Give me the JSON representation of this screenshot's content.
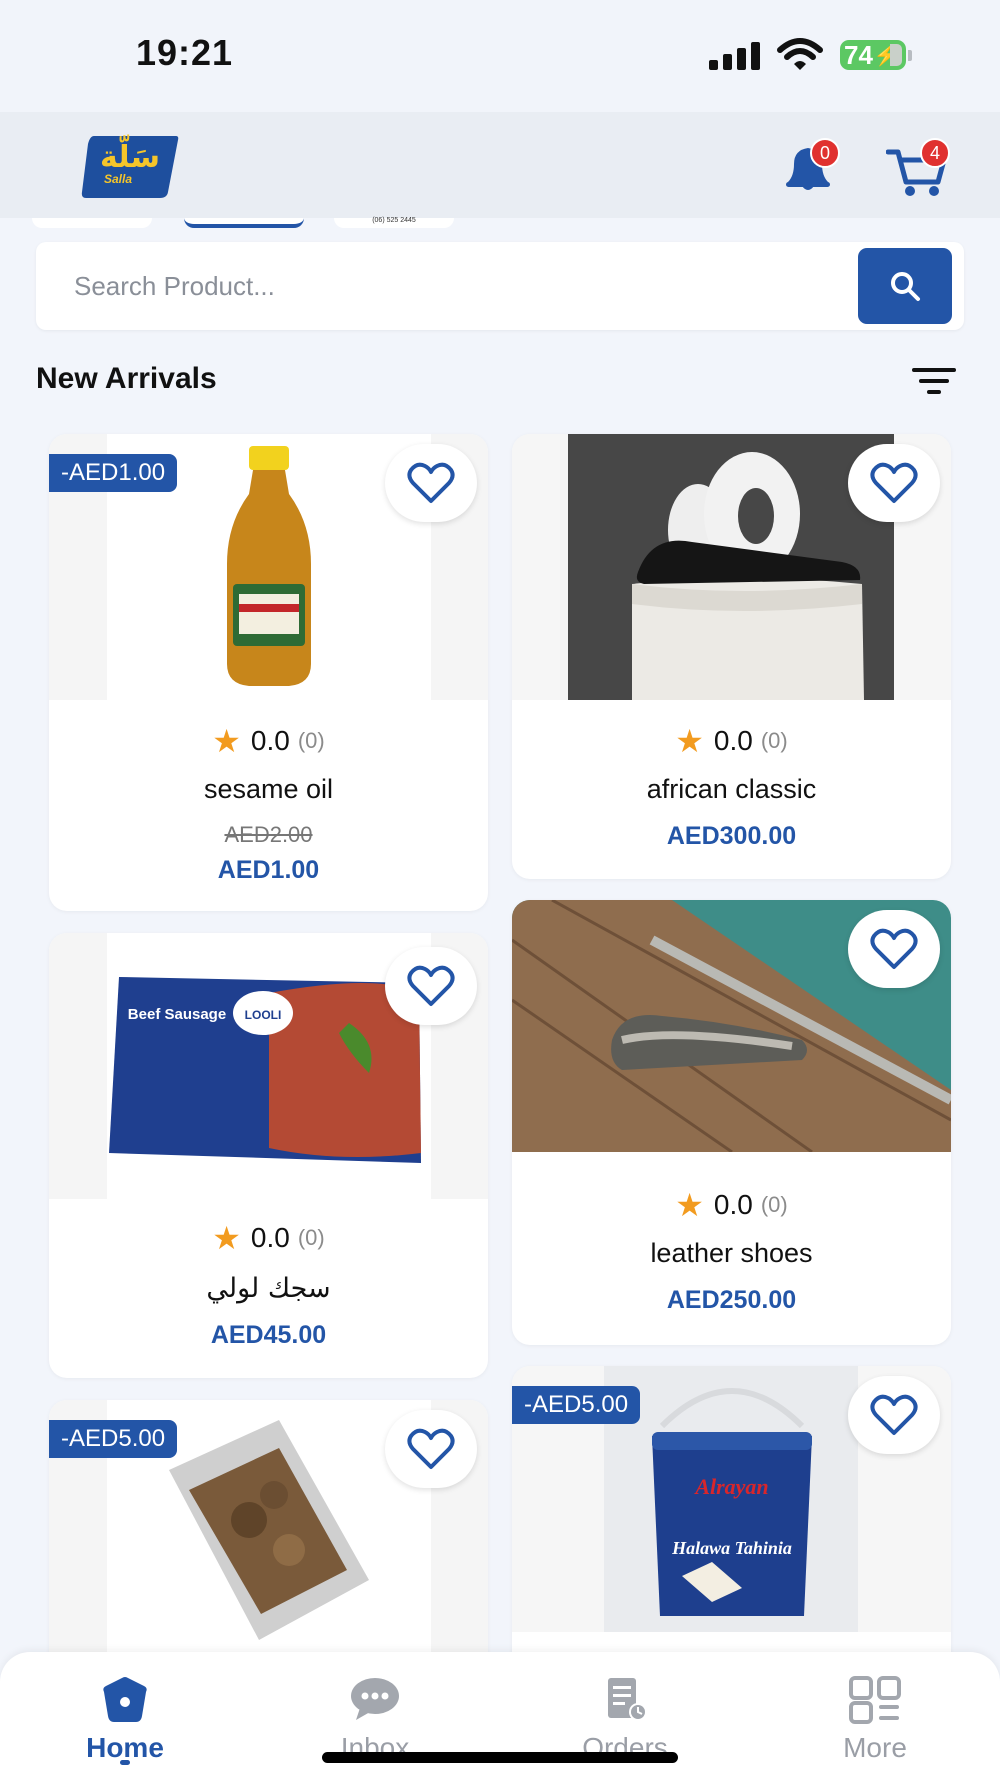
{
  "status_bar": {
    "time": "19:21",
    "battery": "74"
  },
  "header": {
    "logo_ar": "سَلّة",
    "logo_en": "Salla",
    "notifications_count": "0",
    "cart_count": "4"
  },
  "banner_fragment_text": "(06) 525 2445",
  "search": {
    "placeholder": "Search Product..."
  },
  "section": {
    "title": "New Arrivals"
  },
  "products": [
    {
      "name": "sesame oil",
      "rating": "0.0",
      "reviews": "(0)",
      "old_price": "AED2.00",
      "price": "AED1.00",
      "discount": "-AED1.00",
      "image": "sesame-oil-bottle"
    },
    {
      "name": "african classic",
      "rating": "0.0",
      "reviews": "(0)",
      "price": "AED300.00",
      "image": "black-shoe-on-pedestal"
    },
    {
      "name": "سجك لولي",
      "rating": "0.0",
      "reviews": "(0)",
      "price": "AED45.00",
      "image": "beef-sausage-pack",
      "package_text": "Beef Sausage",
      "brand_text": "LOOLI"
    },
    {
      "name": "leather shoes",
      "rating": "0.0",
      "reviews": "(0)",
      "price": "AED250.00",
      "image": "snakeskin-loafer-on-dock"
    },
    {
      "discount": "-AED5.00",
      "image": "dried-cookies-bag"
    },
    {
      "discount": "-AED5.00",
      "image": "halawa-tahinia-tub",
      "package_text": "Halawa Tahinia",
      "brand_text": "Alrayan"
    }
  ],
  "bottom_nav": [
    {
      "label": "Home",
      "icon": "home-icon",
      "active": true
    },
    {
      "label": "Inbox",
      "icon": "chat-icon"
    },
    {
      "label": "Orders",
      "icon": "orders-icon"
    },
    {
      "label": "More",
      "icon": "grid-icon"
    }
  ],
  "colors": {
    "brand_blue": "#2355a7",
    "badge_red": "#e0312f",
    "star": "#f29b1f",
    "logo_yellow": "#f5c52a"
  }
}
